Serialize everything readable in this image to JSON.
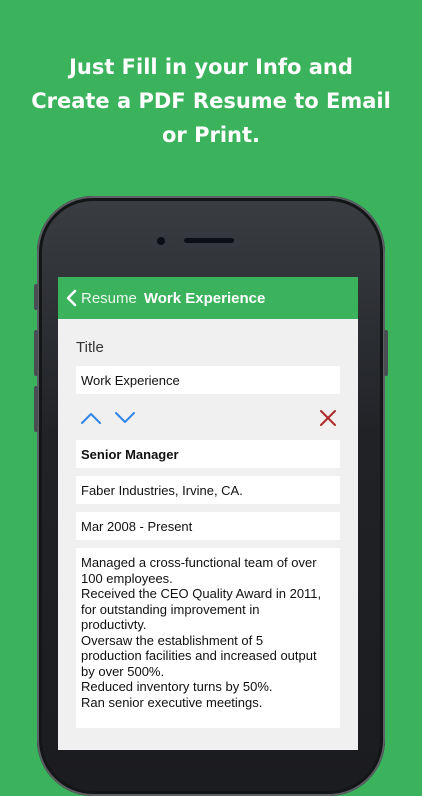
{
  "headline": {
    "line1": "Just Fill in your Info and",
    "line2": "Create a PDF Resume to Email",
    "line3": "or Print."
  },
  "navbar": {
    "back_label": "Resume",
    "title": "Work Experience"
  },
  "form": {
    "title_label": "Title",
    "title_value": "Work Experience",
    "position": "Senior Manager",
    "company": "Faber Industries, Irvine, CA.",
    "dates": "Mar 2008 - Present",
    "description_lines": [
      "Managed a cross-functional team of over",
      "100 employees.",
      "Received the CEO Quality Award in 2011,",
      "for outstanding improvement in",
      "productivty.",
      "Oversaw the establishment of 5",
      "production facilities and increased output",
      "by over 500%.",
      "Reduced inventory turns by 50%.",
      "Ran senior executive meetings."
    ]
  },
  "colors": {
    "background": "#3bb35c",
    "navbar": "#3bb35c",
    "arrow_blue": "#2f86e6",
    "delete_red": "#b22a2a"
  },
  "icons": {
    "back": "chevron-left-icon",
    "move_up": "chevron-up-icon",
    "move_down": "chevron-down-icon",
    "delete": "close-icon"
  }
}
